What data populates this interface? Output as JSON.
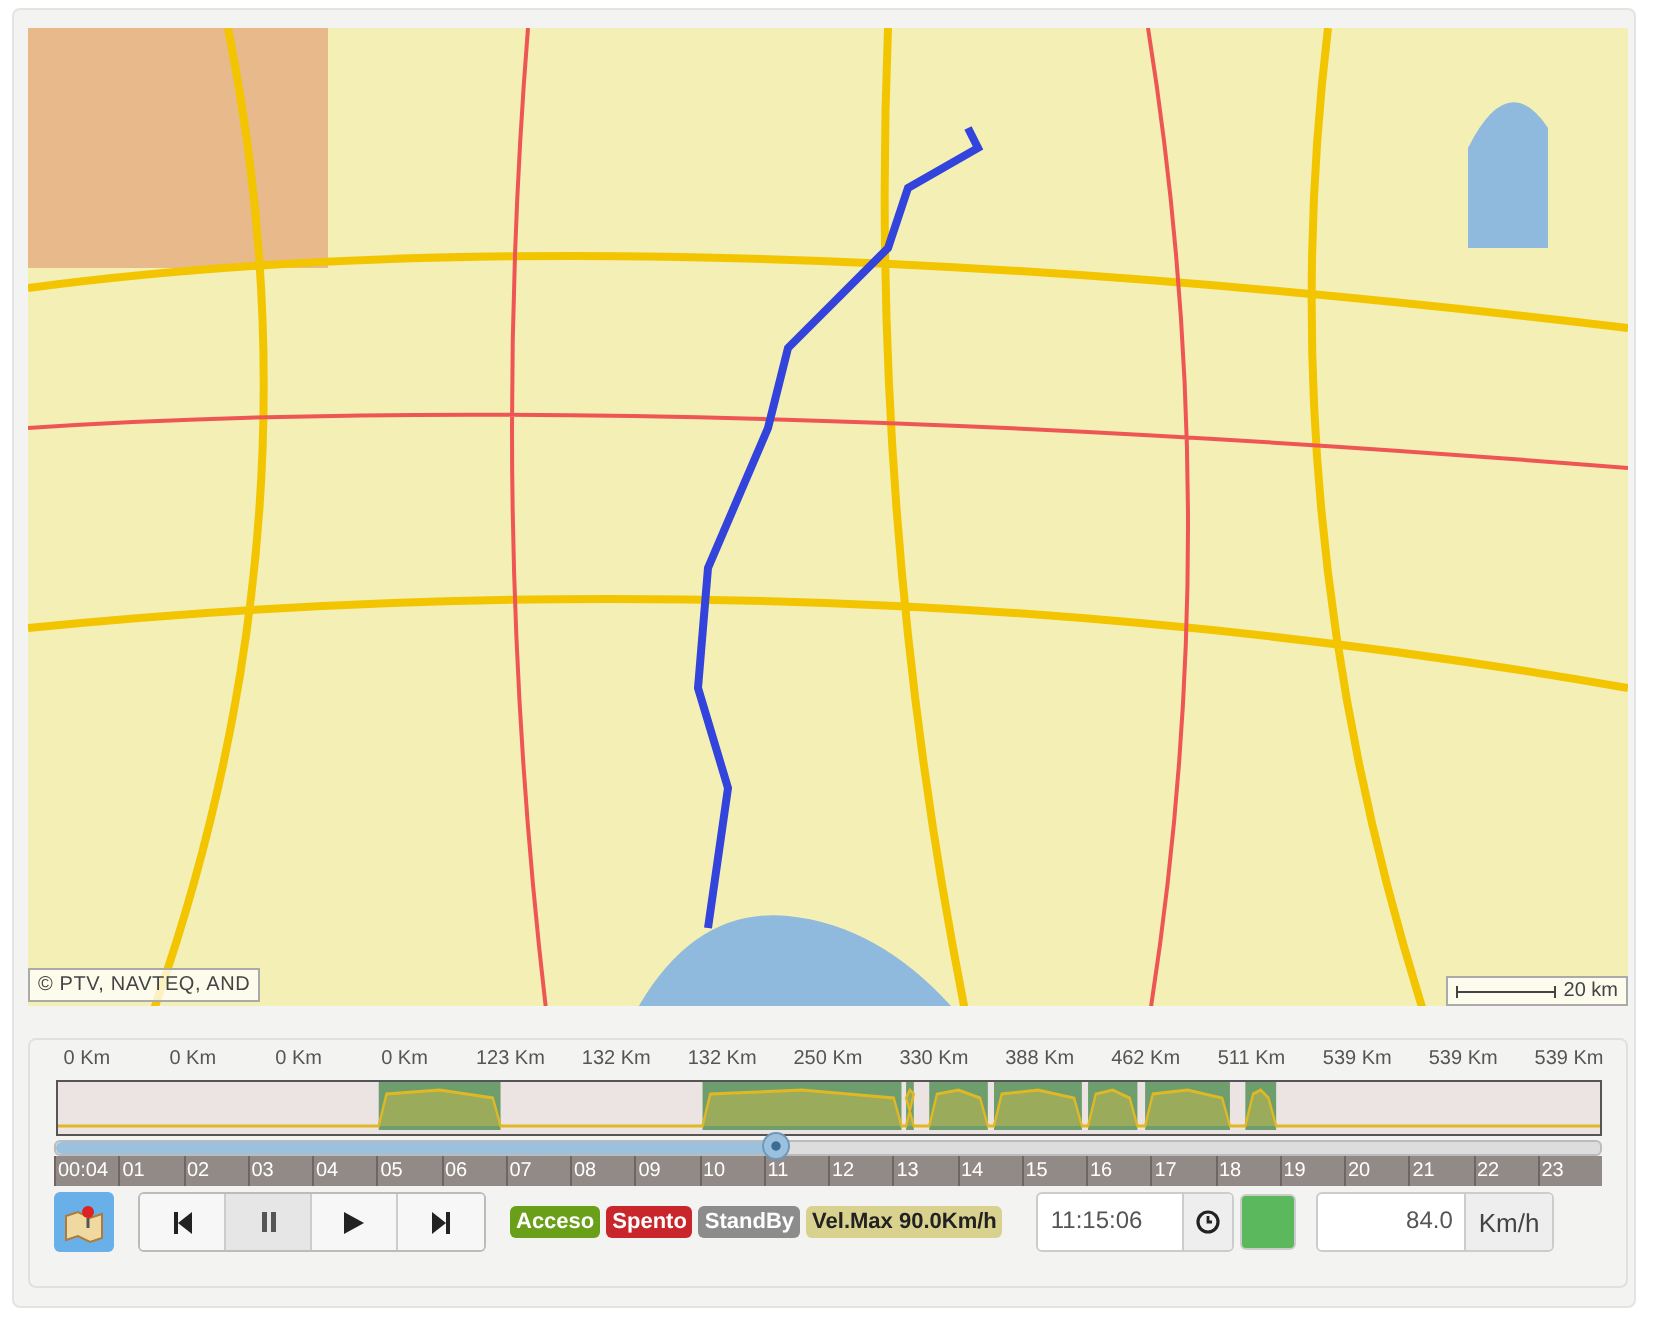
{
  "map": {
    "attribution": "© PTV, NAVTEQ, AND",
    "scale": "20 km"
  },
  "timeline": {
    "distances": [
      "0 Km",
      "0 Km",
      "0 Km",
      "0 Km",
      "123 Km",
      "132 Km",
      "132 Km",
      "250 Km",
      "330 Km",
      "388 Km",
      "462 Km",
      "511 Km",
      "539 Km",
      "539 Km",
      "539 Km"
    ],
    "level": 0.466,
    "hours": [
      "00:04",
      "01",
      "02",
      "03",
      "04",
      "05",
      "06",
      "07",
      "08",
      "09",
      "10",
      "11",
      "12",
      "13",
      "14",
      "15",
      "16",
      "17",
      "18",
      "19",
      "20",
      "21",
      "22",
      "23"
    ]
  },
  "controls": {
    "playback": [
      {
        "kind": "first",
        "selected": false
      },
      {
        "kind": "pause",
        "selected": true
      },
      {
        "kind": "play",
        "selected": false
      },
      {
        "kind": "last",
        "selected": false
      }
    ],
    "legend": [
      {
        "label": "Acceso",
        "color": "#6a9f1a"
      },
      {
        "label": "Spento",
        "color": "#c8262a"
      },
      {
        "label": "StandBy",
        "color": "#8c8c8c"
      },
      {
        "label": "Vel.Max 90.0Km/h",
        "color": "#d9d28f"
      }
    ],
    "time": "11:15:06",
    "status": {
      "color": "#5cb85c"
    },
    "speed": "84.0",
    "speed_unit": "Km/h"
  }
}
